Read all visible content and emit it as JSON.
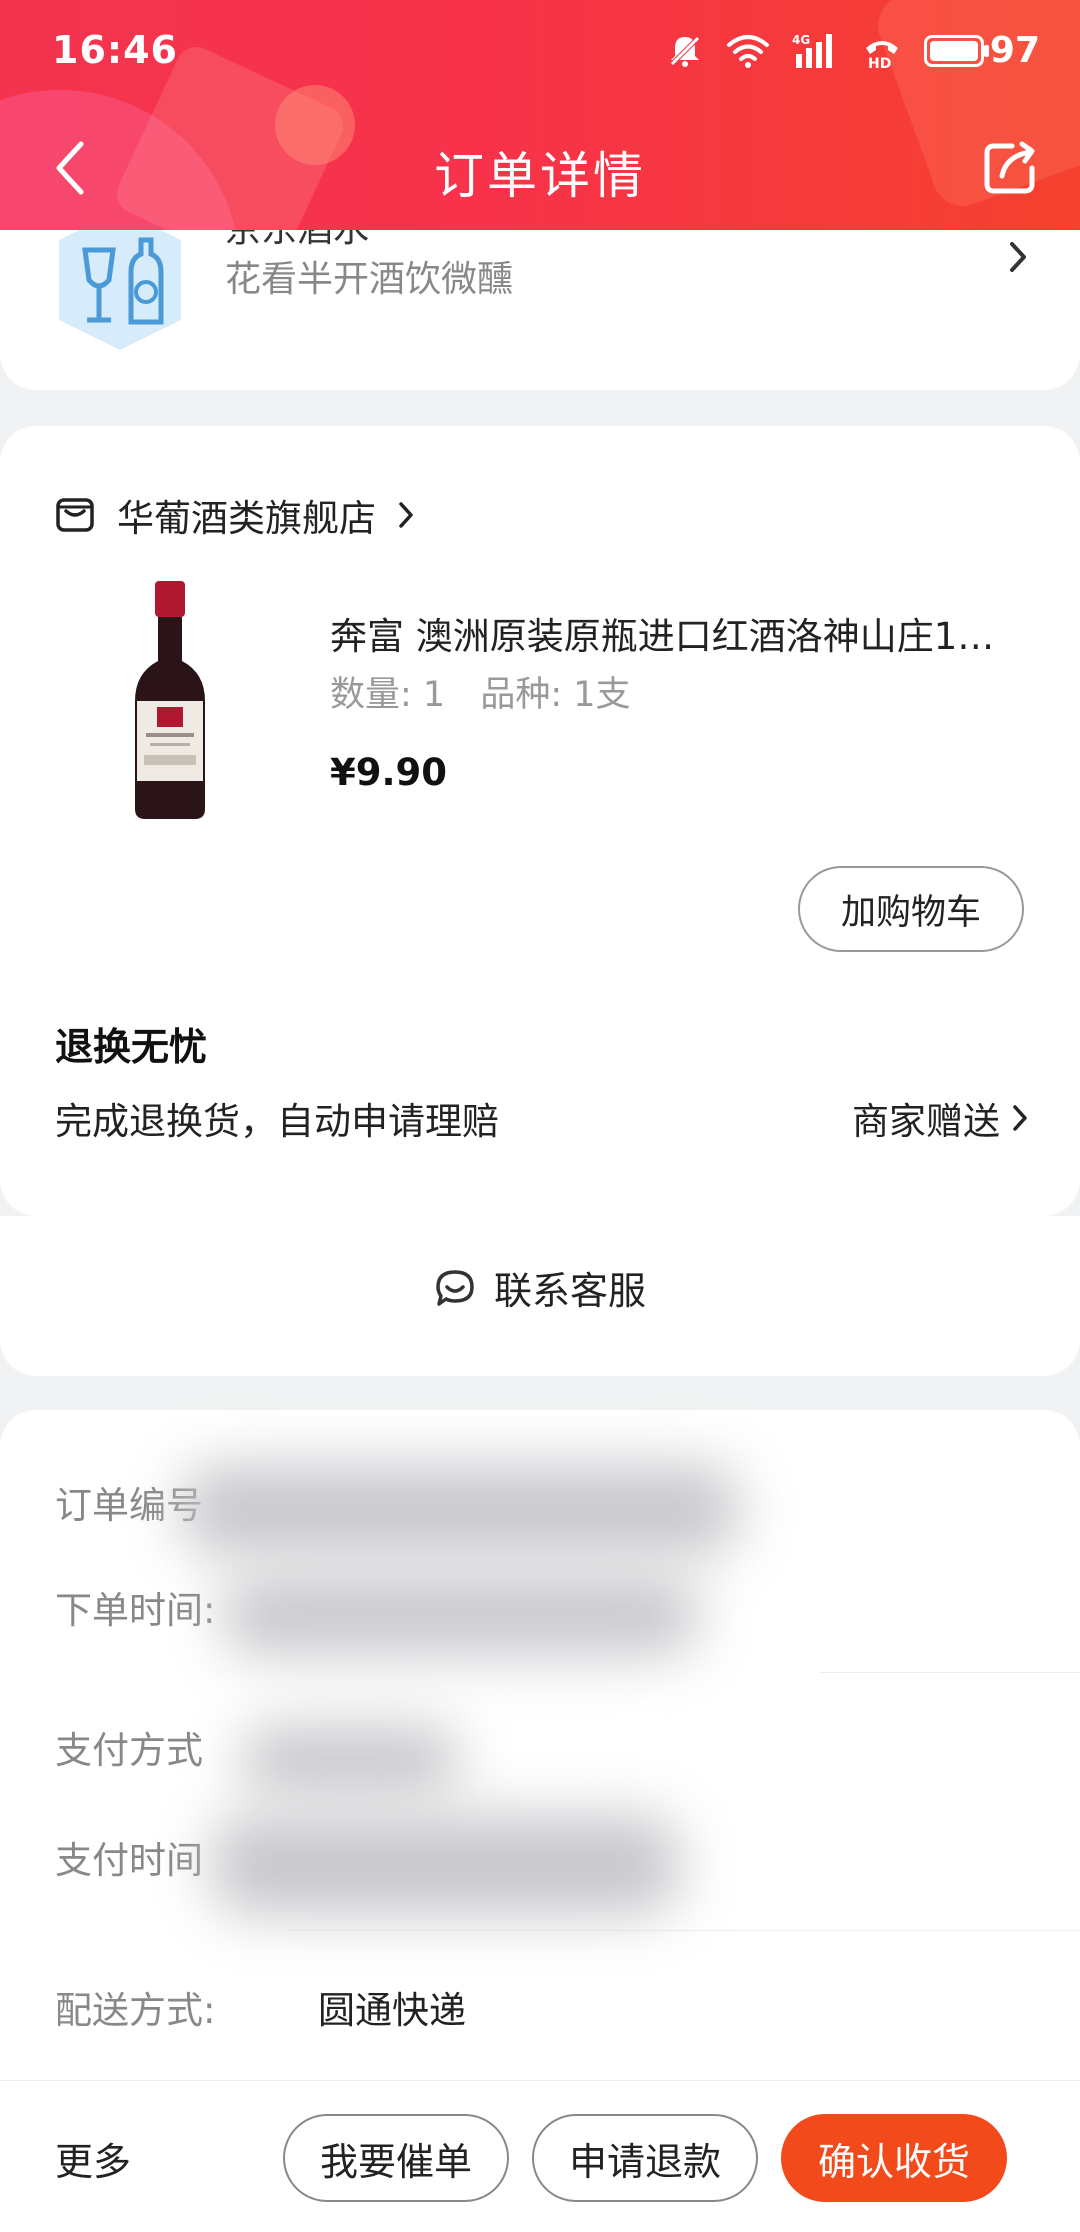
{
  "status_bar": {
    "time": "16:46",
    "battery_pct": "97",
    "network_label": "4G",
    "hd_label": "HD"
  },
  "nav": {
    "title": "订单详情"
  },
  "promo": {
    "title": "京东酒水",
    "subtitle": "花看半开酒饮微醺"
  },
  "store": {
    "name": "华葡酒类旗舰店"
  },
  "product": {
    "title": "奔富 澳洲原装原瓶进口红酒洛神山庄1…",
    "quantity": "数量: 1",
    "variant": "品种: 1支",
    "price": "¥9.90",
    "add_to_cart_label": "加购物车"
  },
  "guarantee": {
    "title": "退换无忧",
    "description": "完成退换货，自动申请理赔",
    "gift_label": "商家赠送"
  },
  "service": {
    "label": "联系客服"
  },
  "order_info": {
    "order_number_label": "订单编号",
    "order_time_label": "下单时间:",
    "payment_method_label": "支付方式",
    "payment_time_label": "支付时间",
    "delivery_label": "配送方式:",
    "delivery_value": "圆通快递"
  },
  "bottom_bar": {
    "more_label": "更多",
    "urge_label": "我要催单",
    "refund_label": "申请退款",
    "confirm_label": "确认收货"
  },
  "colors": {
    "header_red": "#f4344f",
    "primary_orange": "#f24a1a",
    "promo_logo_blue": "#4a9ad8"
  }
}
